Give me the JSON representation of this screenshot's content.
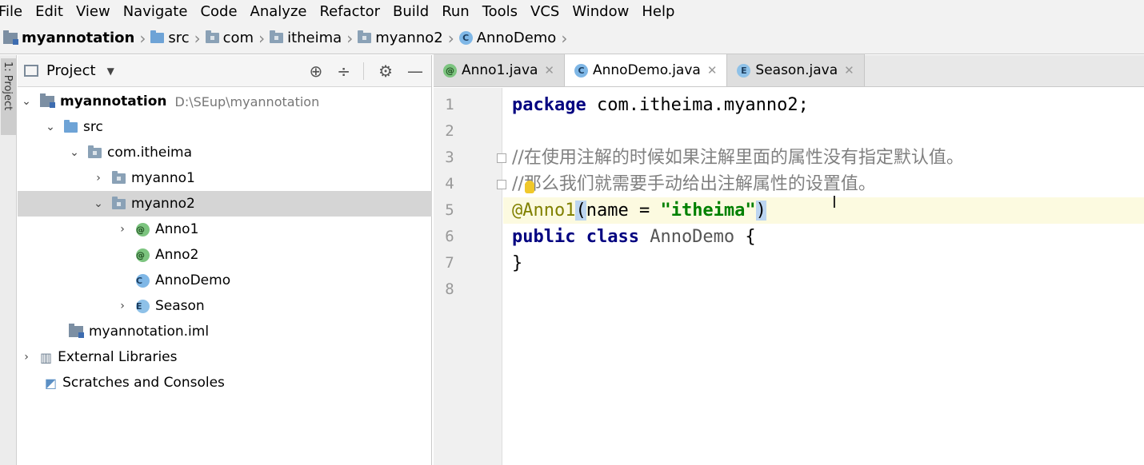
{
  "menu": [
    "File",
    "Edit",
    "View",
    "Navigate",
    "Code",
    "Analyze",
    "Refactor",
    "Build",
    "Run",
    "Tools",
    "VCS",
    "Window",
    "Help"
  ],
  "breadcrumb": [
    "myannotation",
    "src",
    "com",
    "itheima",
    "myanno2",
    "AnnoDemo"
  ],
  "sidebar_tab": "1: Project",
  "project_panel": {
    "title": "Project",
    "tree": [
      {
        "label": "myannotation",
        "extra": "D:\\SEup\\myannotation"
      },
      {
        "label": "src"
      },
      {
        "label": "com.itheima"
      },
      {
        "label": "myanno1"
      },
      {
        "label": "myanno2"
      },
      {
        "label": "Anno1"
      },
      {
        "label": "Anno2"
      },
      {
        "label": "AnnoDemo"
      },
      {
        "label": "Season"
      },
      {
        "label": "myannotation.iml"
      },
      {
        "label": "External Libraries"
      },
      {
        "label": "Scratches and Consoles"
      }
    ]
  },
  "tabs": [
    {
      "label": "Anno1.java",
      "icon": "annotation-icon"
    },
    {
      "label": "AnnoDemo.java",
      "icon": "class-icon",
      "active": true
    },
    {
      "label": "Season.java",
      "icon": "enum-icon"
    }
  ],
  "editor": {
    "line_numbers": [
      "1",
      "2",
      "3",
      "4",
      "5",
      "6",
      "7",
      "8"
    ],
    "current_line": 5,
    "code": {
      "l1_kw": "package",
      "l1_rest": " com.itheima.myanno2;",
      "l3": "//在使用注解的时候如果注解里面的属性没有指定默认值。",
      "l4": "//那么我们就需要手动给出注解属性的设置值。",
      "l5_ann": "@Anno1",
      "l5_open": "(",
      "l5_mid": "name = ",
      "l5_str": "\"itheima\"",
      "l5_close": ")",
      "l6_kw": "public class",
      "l6_name": "AnnoDemo",
      "l6_rest": " {",
      "l7": "}"
    }
  }
}
